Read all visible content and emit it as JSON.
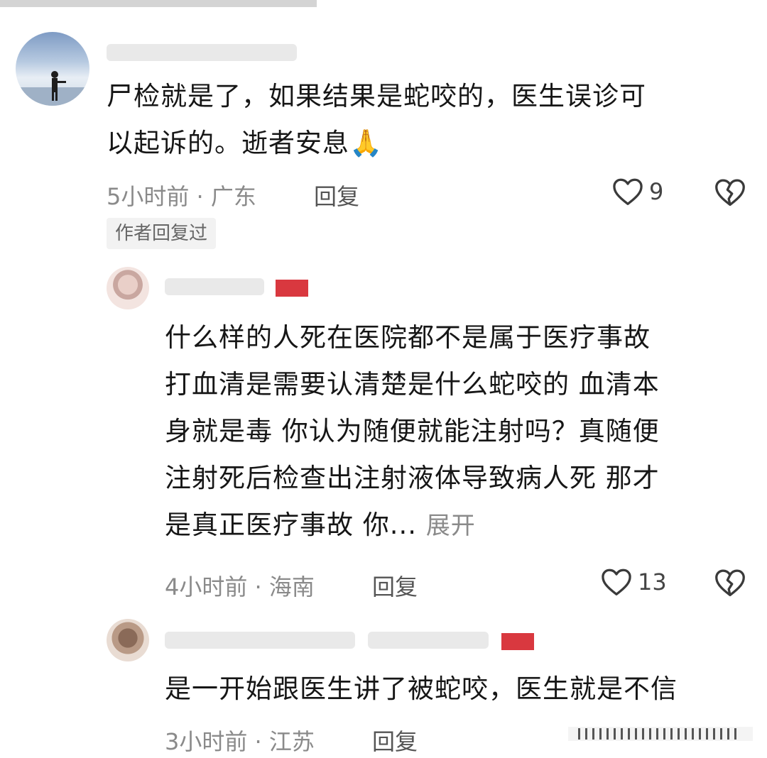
{
  "comments": [
    {
      "text": "尸检就是了，如果结果是蛇咬的，医生误诊可\n以起诉的。逝者安息🙏",
      "time_location": "5小时前 · 广东",
      "reply_label": "回复",
      "likes": "9",
      "author_tag": "作者回复过"
    },
    {
      "text": "什么样的人死在医院都不是属于医疗事故\n打血清是需要认清楚是什么蛇咬的  血清本\n身就是毒  你认为随便就能注射吗？真随便\n注射死后检查出注射液体导致病人死 那才\n是真正医疗事故  你...",
      "expand_label": "展开",
      "time_location": "4小时前 · 海南",
      "reply_label": "回复",
      "likes": "13"
    },
    {
      "text": "是一开始跟医生讲了被蛇咬，医生就是不信",
      "time_location": "3小时前 · 江苏",
      "reply_label": "回复"
    }
  ],
  "colors": {
    "badge_red": "#d9383f",
    "meta_gray": "#8a8a8a"
  },
  "icons": [
    "heart-outline-icon",
    "broken-heart-icon"
  ]
}
